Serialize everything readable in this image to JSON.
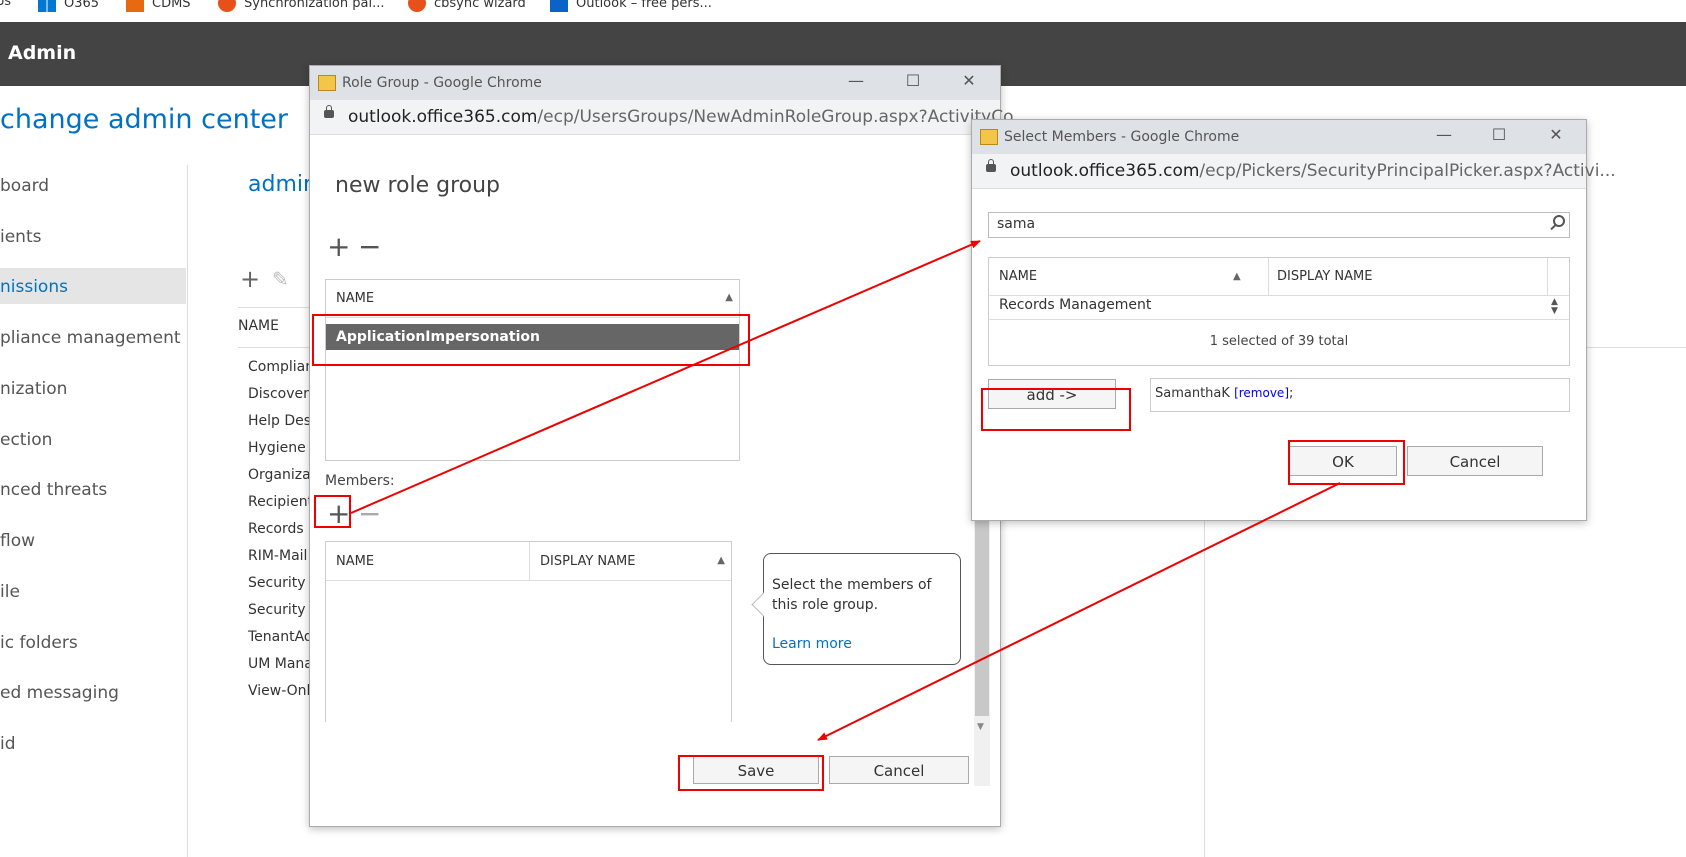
{
  "bookmarks": [
    {
      "label": "ps",
      "icon": "apps-icon"
    },
    {
      "label": "O365",
      "icon": "windows-logo-icon"
    },
    {
      "label": "CDMS",
      "icon": "cdms-icon"
    },
    {
      "label": "Synchronization pal...",
      "icon": "sync-icon"
    },
    {
      "label": "cbsync wizard",
      "icon": "sync-icon"
    },
    {
      "label": "Outlook – free pers...",
      "icon": "outlook-icon"
    }
  ],
  "header": {
    "title": "Admin"
  },
  "app_title": "change admin center",
  "nav": [
    "board",
    "ients",
    "nissions",
    "pliance management",
    "nization",
    "ection",
    "nced threats",
    "flow",
    "ile",
    "ic folders",
    "ed messaging",
    "id"
  ],
  "nav_selected_index": 2,
  "page": {
    "title": "admin",
    "column_name": "NAME"
  },
  "background_rows": [
    "Complian",
    "Discovery",
    "Help Des",
    "Hygiene I",
    "Organizat",
    "Recipient",
    "Records M",
    "RIM-Mail",
    "Security A",
    "Security R",
    "TenantAd",
    "UM Mana",
    "View-Onl"
  ],
  "role_dialog": {
    "title": "Role Group - Google Chrome",
    "url_host": "outlook.office365.com",
    "url_path": "/ecp/UsersGroups/NewAdminRoleGroup.aspx?ActivityCo...",
    "heading": "new role group",
    "roles_header": "NAME",
    "roles": [
      "ApplicationImpersonation"
    ],
    "members_label": "Members:",
    "members_headers": [
      "NAME",
      "DISPLAY NAME"
    ],
    "callout_text": "Select the members of this role group.",
    "callout_link": "Learn more",
    "save_label": "Save",
    "cancel_label": "Cancel"
  },
  "picker_dialog": {
    "title": "Select Members - Google Chrome",
    "url_host": "outlook.office365.com",
    "url_path": "/ecp/Pickers/SecurityPrincipalPicker.aspx?Activi...",
    "search_value": "sama",
    "headers": [
      "NAME",
      "DISPLAY NAME"
    ],
    "rows": [
      "Records Management"
    ],
    "status": "1 selected of 39 total",
    "add_label": "add ->",
    "selected_member": "SamanthaK",
    "remove_label": "[remove]",
    "separator": ";",
    "ok_label": "OK",
    "cancel_label": "Cancel"
  },
  "colors": {
    "accent": "#0072c6",
    "header_bg": "#444444",
    "annotation": "#e00000",
    "selected_row": "#666666"
  }
}
